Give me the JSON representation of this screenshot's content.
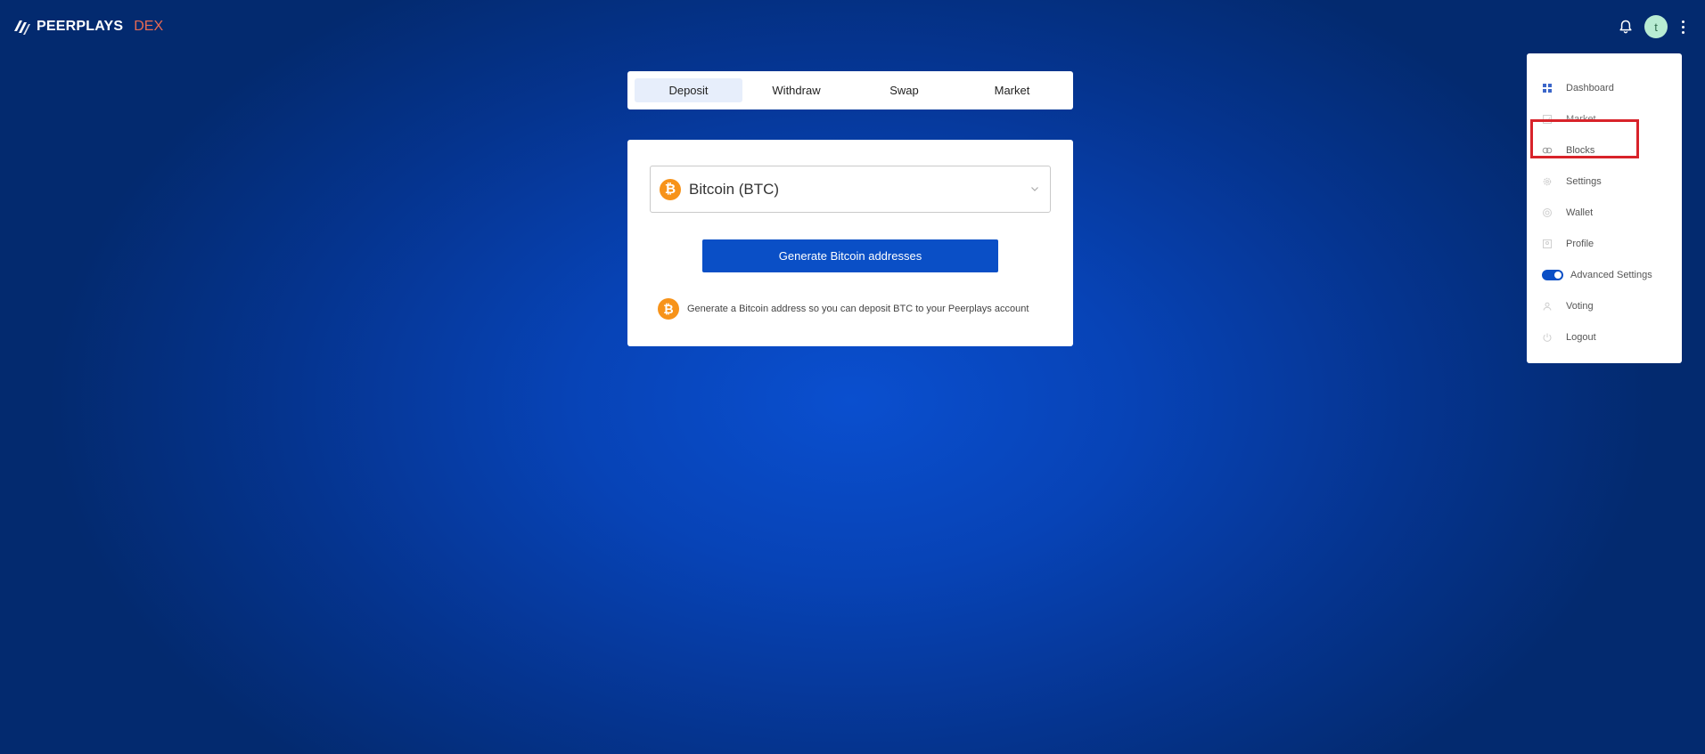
{
  "header": {
    "logo_text": "PEERPLAYS",
    "logo_suffix": "DEX",
    "avatar_initial": "t"
  },
  "tabs": [
    {
      "label": "Deposit",
      "active": true
    },
    {
      "label": "Withdraw",
      "active": false
    },
    {
      "label": "Swap",
      "active": false
    },
    {
      "label": "Market",
      "active": false
    }
  ],
  "deposit": {
    "selected_asset": "Bitcoin (BTC)",
    "asset_icon": "bitcoin-icon",
    "button_label": "Generate Bitcoin addresses",
    "info_text": "Generate a Bitcoin address so you can deposit BTC to your Peerplays account"
  },
  "menu": {
    "items": [
      {
        "label": "Dashboard",
        "icon": "dashboard-icon"
      },
      {
        "label": "Market",
        "icon": "market-icon"
      },
      {
        "label": "Blocks",
        "icon": "blocks-icon",
        "highlighted": true
      },
      {
        "label": "Settings",
        "icon": "gear-icon"
      },
      {
        "label": "Wallet",
        "icon": "wallet-icon"
      },
      {
        "label": "Profile",
        "icon": "profile-icon"
      },
      {
        "label": "Advanced Settings",
        "icon": "toggle-icon",
        "toggle_on": true
      },
      {
        "label": "Voting",
        "icon": "voting-icon"
      },
      {
        "label": "Logout",
        "icon": "power-icon"
      }
    ]
  },
  "colors": {
    "accent": "#0a4fc6",
    "bitcoin": "#f7931a",
    "logo_suffix": "#e96a52",
    "highlight": "#d8232a"
  }
}
